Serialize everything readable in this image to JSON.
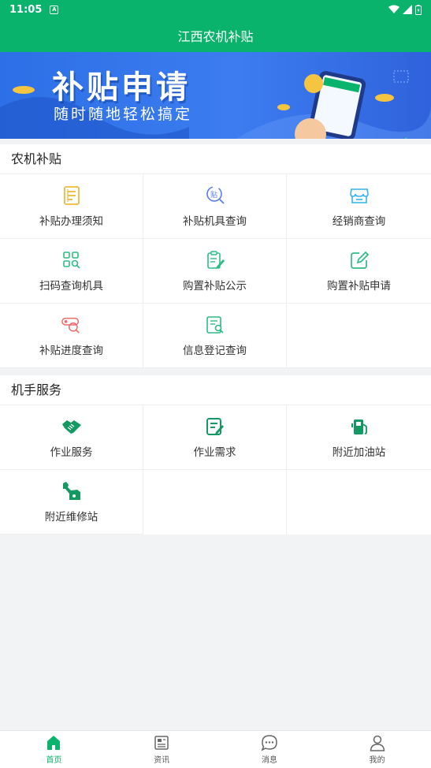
{
  "status_bar": {
    "time": "11:05",
    "notification_glyph": "A"
  },
  "header": {
    "title": "江西农机补贴"
  },
  "banner": {
    "title": "补贴申请",
    "subtitle": "随时随地轻松搞定"
  },
  "sections": [
    {
      "title": "农机补贴",
      "items": [
        {
          "label": "补贴办理须知",
          "icon": "document-icon",
          "color": "#f0b93a"
        },
        {
          "label": "补贴机具查询",
          "icon": "subsidy-search-icon",
          "color": "#5a7de8"
        },
        {
          "label": "经销商查询",
          "icon": "store-icon",
          "color": "#33b5e5"
        },
        {
          "label": "扫码查询机具",
          "icon": "qr-scan-icon",
          "color": "#2dbd84"
        },
        {
          "label": "购置补贴公示",
          "icon": "notice-icon",
          "color": "#2dbd84"
        },
        {
          "label": "购置补贴申请",
          "icon": "edit-icon",
          "color": "#2dbd84"
        },
        {
          "label": "补贴进度查询",
          "icon": "progress-search-icon",
          "color": "#f06a6a"
        },
        {
          "label": "信息登记查询",
          "icon": "register-search-icon",
          "color": "#2dbd84"
        }
      ]
    },
    {
      "title": "机手服务",
      "items": [
        {
          "label": "作业服务",
          "icon": "handshake-icon",
          "color": "#129a62"
        },
        {
          "label": "作业需求",
          "icon": "request-icon",
          "color": "#129a62"
        },
        {
          "label": "附近加油站",
          "icon": "gas-station-icon",
          "color": "#129a62"
        },
        {
          "label": "附近维修站",
          "icon": "repair-icon",
          "color": "#129a62"
        }
      ]
    }
  ],
  "tabs": [
    {
      "label": "首页",
      "icon": "home-icon",
      "active": true
    },
    {
      "label": "资讯",
      "icon": "news-icon",
      "active": false
    },
    {
      "label": "消息",
      "icon": "message-icon",
      "active": false
    },
    {
      "label": "我的",
      "icon": "profile-icon",
      "active": false
    }
  ],
  "colors": {
    "brand": "#09b36b",
    "banner": "#2d6fe6"
  }
}
